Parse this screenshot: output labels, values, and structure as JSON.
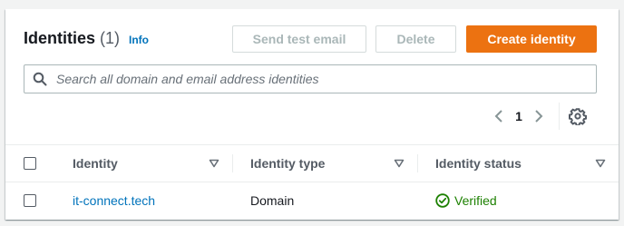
{
  "header": {
    "title": "Identities",
    "count": "(1)",
    "info_label": "Info"
  },
  "buttons": {
    "send_test_email": "Send test email",
    "delete": "Delete",
    "create_identity": "Create identity"
  },
  "search": {
    "placeholder": "Search all domain and email address identities",
    "value": ""
  },
  "pagination": {
    "current_page": "1"
  },
  "table": {
    "columns": [
      "Identity",
      "Identity type",
      "Identity status"
    ],
    "rows": [
      {
        "identity": "it-connect.tech",
        "type": "Domain",
        "status": "Verified"
      }
    ]
  },
  "colors": {
    "primary": "#ec7211",
    "link": "#0073bb",
    "success": "#1d8102"
  }
}
